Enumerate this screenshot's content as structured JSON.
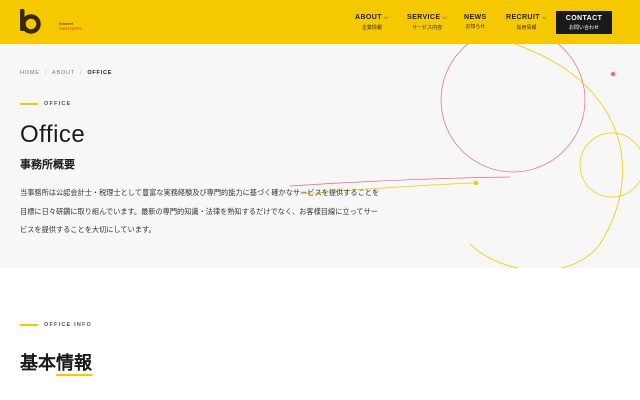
{
  "brand": {
    "logo_letter": "b",
    "logo_line1": "bdcmet",
    "logo_line2": "PARTNERS",
    "colors": {
      "accent": "#f6c800",
      "dark": "#1a1a1a",
      "hero_bg": "#f7f7f7",
      "line_red": "#ec6a7c"
    }
  },
  "nav": {
    "items": [
      {
        "label": "ABOUT",
        "sub": "企業情報",
        "has_dropdown": true
      },
      {
        "label": "SERVICE",
        "sub": "サービス内容",
        "has_dropdown": true
      },
      {
        "label": "NEWS",
        "sub": "お知らせ",
        "has_dropdown": false
      },
      {
        "label": "RECRUIT",
        "sub": "採用情報",
        "has_dropdown": true
      }
    ],
    "chevron": "⌵",
    "contact": {
      "label": "CONTACT",
      "sub": "お問い合わせ"
    }
  },
  "breadcrumb": {
    "items": [
      "HOME",
      "ABOUT"
    ],
    "current": "OFFICE",
    "separator": "/"
  },
  "hero": {
    "eyebrow": "OFFICE",
    "title": "Office",
    "subtitle": "事務所概要",
    "lead": "当事務所は公認会計士・税理士として豊富な実務経験及び専門的能力に基づく確かなサービスを提供することを目標に日々研鑽に取り組んでいます。最新の専門的知識・法律を熟知するだけでなく、お客様目線に立ってサービスを提供することを大切にしています。"
  },
  "info": {
    "eyebrow": "OFFICE INFO",
    "title": "基本情報"
  }
}
